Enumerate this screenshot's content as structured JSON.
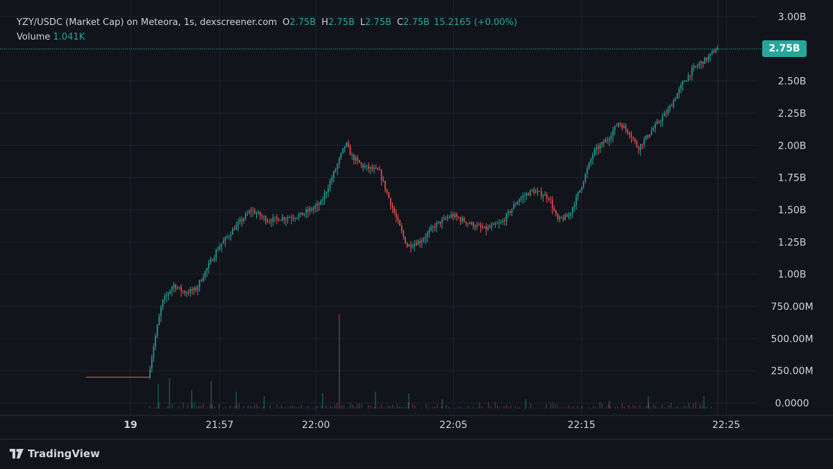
{
  "legend": {
    "title": "YZY/USDC (Market Cap) on Meteora, 1s, dexscreener.com",
    "o_label": "O",
    "o_value": "2.75B",
    "h_label": "H",
    "h_value": "2.75B",
    "l_label": "L",
    "l_value": "2.75B",
    "c_label": "C",
    "c_value": "2.75B",
    "change": "15.2165 (+0.00%)",
    "volume_label": "Volume",
    "volume_value": "1.041K"
  },
  "branding": {
    "name": "TradingView"
  },
  "colors": {
    "up": "#26a69a",
    "down": "#ef5350",
    "background": "#12141c",
    "grid": "#1f2230",
    "text": "#d1d4dc",
    "price_line": "#26a69a"
  },
  "chart_data": {
    "type": "candlestick",
    "last_price_label": "2.75B",
    "last_price_value": 2.75,
    "y_unit": "B",
    "y_ticks": [
      {
        "label": "3.00B",
        "value": 3.0
      },
      {
        "label": "2.75B",
        "value": 2.75
      },
      {
        "label": "2.50B",
        "value": 2.5
      },
      {
        "label": "2.25B",
        "value": 2.25
      },
      {
        "label": "2.00B",
        "value": 2.0
      },
      {
        "label": "1.75B",
        "value": 1.75
      },
      {
        "label": "1.50B",
        "value": 1.5
      },
      {
        "label": "1.25B",
        "value": 1.25
      },
      {
        "label": "1.00B",
        "value": 1.0
      },
      {
        "label": "750.00M",
        "value": 0.75
      },
      {
        "label": "500.00M",
        "value": 0.5
      },
      {
        "label": "250.00M",
        "value": 0.25
      },
      {
        "label": "0.0000",
        "value": 0.0
      }
    ],
    "x_ticks": [
      {
        "label": "19",
        "bold": true,
        "frac": 0.0
      },
      {
        "label": "21:57",
        "bold": false,
        "frac": 0.16
      },
      {
        "label": "22:00",
        "bold": false,
        "frac": 0.333
      },
      {
        "label": "22:05",
        "bold": false,
        "frac": 0.58
      },
      {
        "label": "22:15",
        "bold": false,
        "frac": 0.81
      },
      {
        "label": "22:25",
        "bold": false,
        "frac": 1.07
      }
    ],
    "price_path": [
      [
        0.0,
        0.2
      ],
      [
        0.035,
        0.2
      ],
      [
        0.045,
        0.45
      ],
      [
        0.06,
        0.78
      ],
      [
        0.08,
        0.92
      ],
      [
        0.1,
        0.86
      ],
      [
        0.12,
        0.88
      ],
      [
        0.135,
        1.0
      ],
      [
        0.16,
        1.2
      ],
      [
        0.19,
        1.36
      ],
      [
        0.22,
        1.5
      ],
      [
        0.25,
        1.42
      ],
      [
        0.28,
        1.44
      ],
      [
        0.31,
        1.46
      ],
      [
        0.345,
        1.55
      ],
      [
        0.37,
        1.8
      ],
      [
        0.39,
        2.02
      ],
      [
        0.4,
        1.92
      ],
      [
        0.42,
        1.84
      ],
      [
        0.45,
        1.8
      ],
      [
        0.475,
        1.5
      ],
      [
        0.5,
        1.22
      ],
      [
        0.525,
        1.26
      ],
      [
        0.55,
        1.38
      ],
      [
        0.58,
        1.46
      ],
      [
        0.61,
        1.4
      ],
      [
        0.64,
        1.35
      ],
      [
        0.67,
        1.4
      ],
      [
        0.7,
        1.58
      ],
      [
        0.725,
        1.65
      ],
      [
        0.755,
        1.6
      ],
      [
        0.77,
        1.42
      ],
      [
        0.79,
        1.45
      ],
      [
        0.81,
        1.65
      ],
      [
        0.835,
        1.95
      ],
      [
        0.86,
        2.05
      ],
      [
        0.88,
        2.18
      ],
      [
        0.9,
        2.1
      ],
      [
        0.915,
        1.98
      ],
      [
        0.94,
        2.12
      ],
      [
        0.97,
        2.28
      ],
      [
        0.995,
        2.48
      ],
      [
        1.015,
        2.6
      ],
      [
        1.04,
        2.68
      ],
      [
        1.055,
        2.75
      ]
    ],
    "volumes": [
      {
        "x": 0.05,
        "v": 0.16
      },
      {
        "x": 0.07,
        "v": 0.2
      },
      {
        "x": 0.11,
        "v": 0.12
      },
      {
        "x": 0.145,
        "v": 0.18
      },
      {
        "x": 0.19,
        "v": 0.11
      },
      {
        "x": 0.24,
        "v": 0.08
      },
      {
        "x": 0.345,
        "v": 0.1
      },
      {
        "x": 0.375,
        "v": 0.62
      },
      {
        "x": 0.44,
        "v": 0.11
      },
      {
        "x": 0.5,
        "v": 0.1
      },
      {
        "x": 0.56,
        "v": 0.06
      },
      {
        "x": 0.71,
        "v": 0.06
      },
      {
        "x": 0.86,
        "v": 0.05
      },
      {
        "x": 0.93,
        "v": 0.08
      },
      {
        "x": 1.03,
        "v": 0.08
      }
    ]
  }
}
